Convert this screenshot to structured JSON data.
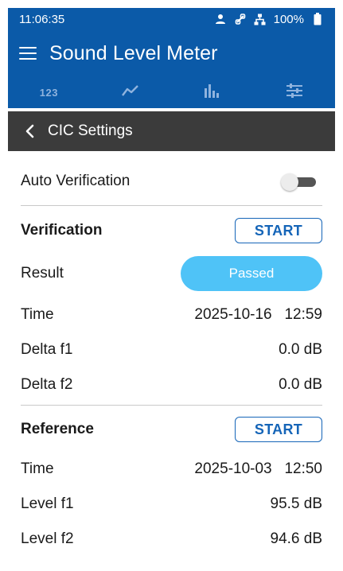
{
  "status_bar": {
    "time": "11:06:35",
    "battery": "100%",
    "icons": [
      "person-icon",
      "link-icon",
      "network-icon",
      "battery-icon"
    ]
  },
  "app_bar": {
    "title": "Sound Level Meter"
  },
  "tabs": [
    {
      "label": "123",
      "icon": "numeric-icon"
    },
    {
      "icon": "line-chart-icon"
    },
    {
      "icon": "bar-chart-icon"
    },
    {
      "icon": "sliders-icon"
    }
  ],
  "sub_header": {
    "title": "CIC Settings"
  },
  "settings": {
    "auto_verification": {
      "label": "Auto Verification",
      "enabled": false
    },
    "verification": {
      "heading": "Verification",
      "start_label": "START",
      "result_label": "Result",
      "result_value": "Passed",
      "time_label": "Time",
      "time_value": "2025-10-16   12:59",
      "delta_f1_label": "Delta f1",
      "delta_f1_value": "0.0 dB",
      "delta_f2_label": "Delta f2",
      "delta_f2_value": "0.0 dB"
    },
    "reference": {
      "heading": "Reference",
      "start_label": "START",
      "time_label": "Time",
      "time_value": "2025-10-03   12:50",
      "level_f1_label": "Level f1",
      "level_f1_value": "95.5 dB",
      "level_f2_label": "Level f2",
      "level_f2_value": "94.6 dB"
    }
  },
  "colors": {
    "primary": "#0b5aa8",
    "sub_header": "#3b3b3b",
    "tab_icon": "#8fb3de",
    "accent": "#1565b8",
    "passed": "#4fc3f7"
  }
}
